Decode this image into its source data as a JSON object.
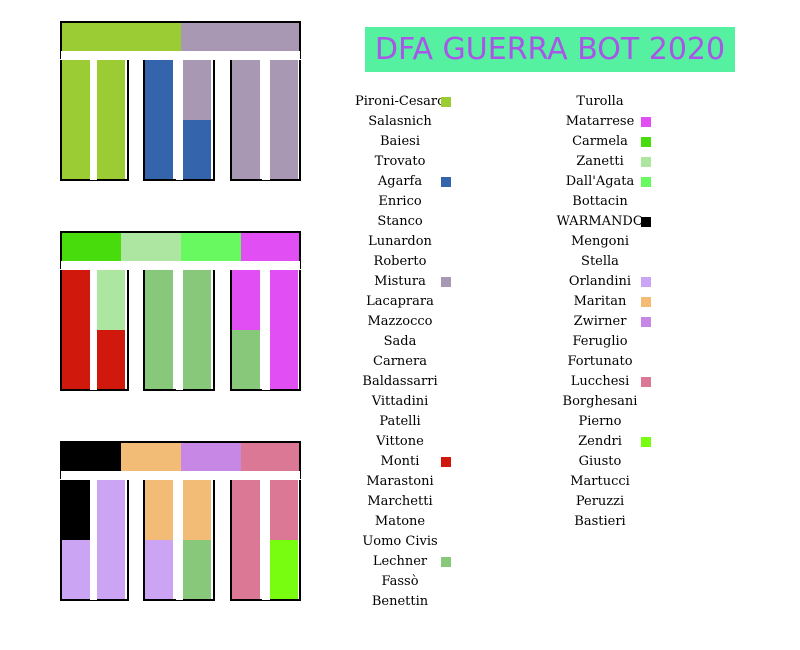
{
  "title": {
    "text": "DFA GUERRA BOT 2020",
    "bg": "#55f0a0",
    "fg": "#a855e8"
  },
  "colors": {
    "border": "#000000",
    "separator": "#ffffff"
  },
  "boards": [
    {
      "top": [
        "#9ccc34",
        "#9ccc34",
        "#a898b4",
        "#a898b4"
      ],
      "bars": [
        [
          "#9ccc34",
          "#9ccc34"
        ],
        [
          "#9ccc34",
          "#9ccc34"
        ],
        [
          "#3464ac",
          "#3464ac"
        ],
        [
          "#a898b4",
          "#3464ac"
        ],
        [
          "#a898b4",
          "#a898b4"
        ],
        [
          "#a898b4",
          "#a898b4"
        ]
      ]
    },
    {
      "top": [
        "#48dc0c",
        "#ace6a0",
        "#68f860",
        "#e04ef4"
      ],
      "bars": [
        [
          "#d0180c",
          "#d0180c"
        ],
        [
          "#ace6a0",
          "#d0180c"
        ],
        [
          "#88c87a",
          "#88c87a"
        ],
        [
          "#88c87a",
          "#88c87a"
        ],
        [
          "#e04ef4",
          "#88c87a"
        ],
        [
          "#e04ef4",
          "#e04ef4"
        ]
      ]
    },
    {
      "top": [
        "#000000",
        "#f2bc76",
        "#c688e4",
        "#da7896"
      ],
      "bars": [
        [
          "#000000",
          "#cca4f4"
        ],
        [
          "#cca4f4",
          "#cca4f4"
        ],
        [
          "#f2bc76",
          "#cca4f4"
        ],
        [
          "#f2bc76",
          "#88c87a"
        ],
        [
          "#da7896",
          "#da7896"
        ],
        [
          "#da7896",
          "#78fc10"
        ]
      ]
    }
  ],
  "players_left": [
    {
      "name": "Pironi-Cesaro",
      "color": "#9ccc34"
    },
    {
      "name": "Salasnich",
      "color": null
    },
    {
      "name": "Baiesi",
      "color": null
    },
    {
      "name": "Trovato",
      "color": null
    },
    {
      "name": "Agarfa",
      "color": "#3464ac"
    },
    {
      "name": "Enrico",
      "color": null
    },
    {
      "name": "Stanco",
      "color": null
    },
    {
      "name": "Lunardon",
      "color": null
    },
    {
      "name": "Roberto",
      "color": null
    },
    {
      "name": "Mistura",
      "color": "#a898b4"
    },
    {
      "name": "Lacaprara",
      "color": null
    },
    {
      "name": "Mazzocco",
      "color": null
    },
    {
      "name": "Sada",
      "color": null
    },
    {
      "name": "Carnera",
      "color": null
    },
    {
      "name": "Baldassarri",
      "color": null
    },
    {
      "name": "Vittadini",
      "color": null
    },
    {
      "name": "Patelli",
      "color": null
    },
    {
      "name": "Vittone",
      "color": null
    },
    {
      "name": "Monti",
      "color": "#d0180c"
    },
    {
      "name": "Marastoni",
      "color": null
    },
    {
      "name": "Marchetti",
      "color": null
    },
    {
      "name": "Matone",
      "color": null
    },
    {
      "name": "Uomo Civis",
      "color": null
    },
    {
      "name": "Lechner",
      "color": "#88c87a"
    },
    {
      "name": "Fassò",
      "color": null
    },
    {
      "name": "Benettin",
      "color": null
    }
  ],
  "players_right": [
    {
      "name": "Turolla",
      "color": null
    },
    {
      "name": "Matarrese",
      "color": "#e04ef4"
    },
    {
      "name": "Carmela",
      "color": "#48dc0c"
    },
    {
      "name": "Zanetti",
      "color": "#ace6a0"
    },
    {
      "name": "Dall'Agata",
      "color": "#68f860"
    },
    {
      "name": "Bottacin",
      "color": null
    },
    {
      "name": "WARMANDO",
      "color": "#000000"
    },
    {
      "name": "Mengoni",
      "color": null
    },
    {
      "name": "Stella",
      "color": null
    },
    {
      "name": "Orlandini",
      "color": "#cca4f4"
    },
    {
      "name": "Maritan",
      "color": "#f2bc76"
    },
    {
      "name": "Zwirner",
      "color": "#c688e4"
    },
    {
      "name": "Feruglio",
      "color": null
    },
    {
      "name": "Fortunato",
      "color": null
    },
    {
      "name": "Lucchesi",
      "color": "#da7896"
    },
    {
      "name": "Borghesani",
      "color": null
    },
    {
      "name": "Pierno",
      "color": null
    },
    {
      "name": "Zendri",
      "color": "#78fc10"
    },
    {
      "name": "Giusto",
      "color": null
    },
    {
      "name": "Martucci",
      "color": null
    },
    {
      "name": "Peruzzi",
      "color": null
    },
    {
      "name": "Bastieri",
      "color": null
    }
  ]
}
